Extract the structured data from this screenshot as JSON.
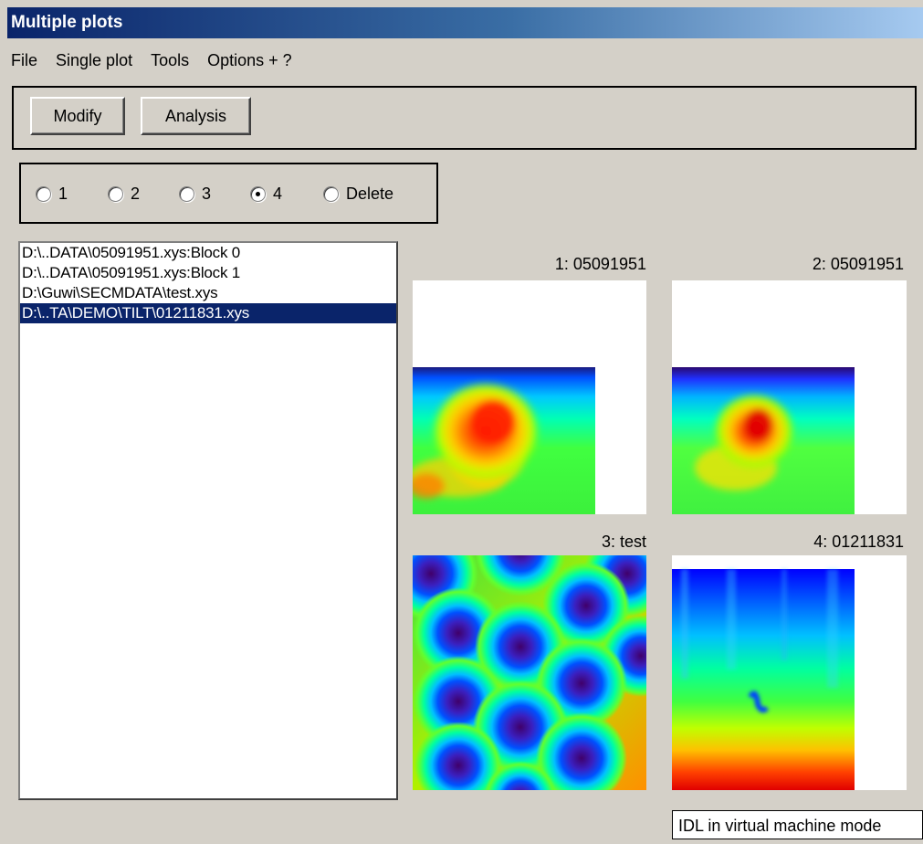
{
  "window": {
    "title": "Multiple plots"
  },
  "menu": {
    "items": [
      "File",
      "Single plot",
      "Tools",
      "Options + ?"
    ]
  },
  "toolbar": {
    "modify_label": "Modify",
    "analysis_label": "Analysis"
  },
  "radios": {
    "options": [
      "1",
      "2",
      "3",
      "4",
      "Delete"
    ],
    "selected": "4"
  },
  "files": {
    "items": [
      "D:\\..DATA\\05091951.xys:Block 0",
      "D:\\..DATA\\05091951.xys:Block 1",
      "D:\\Guwi\\SECMDATA\\test.xys",
      "D:\\..TA\\DEMO\\TILT\\01211831.xys"
    ],
    "selected_index": 3
  },
  "plots": [
    {
      "title": "1: 05091951",
      "colormap": "rainbow"
    },
    {
      "title": "2: 05091951",
      "colormap": "rainbow"
    },
    {
      "title": "3: test",
      "colormap": "rainbow"
    },
    {
      "title": "4: 01211831",
      "colormap": "rainbow"
    }
  ],
  "status": {
    "text": "IDL in virtual machine mode"
  },
  "colors": {
    "titlebar": "#0a246a",
    "selection": "#0a246a",
    "face": "#d4d0c8"
  }
}
